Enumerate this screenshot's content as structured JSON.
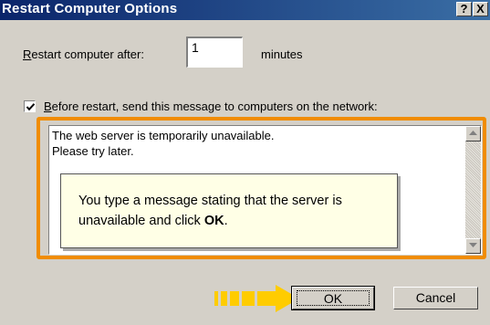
{
  "window": {
    "title": "Restart Computer Options",
    "help_label": "?",
    "close_label": "X"
  },
  "restart": {
    "label_accel": "R",
    "label_rest": "estart computer after:",
    "value": "1",
    "unit": "minutes"
  },
  "message_option": {
    "checked": true,
    "label_accel": "B",
    "label_rest": "efore restart, send this message to computers on the network:",
    "text_line1": "The web server is temporarily unavailable.",
    "text_line2": "Please try later."
  },
  "callout": {
    "text_before": "You type a message stating that the server is unavailable and click ",
    "text_bold": "OK",
    "text_after": "."
  },
  "buttons": {
    "ok": "OK",
    "cancel": "Cancel"
  },
  "colors": {
    "highlight": "#f08c00",
    "arrow": "#ffcc00",
    "title_bar": "#0a246a"
  }
}
